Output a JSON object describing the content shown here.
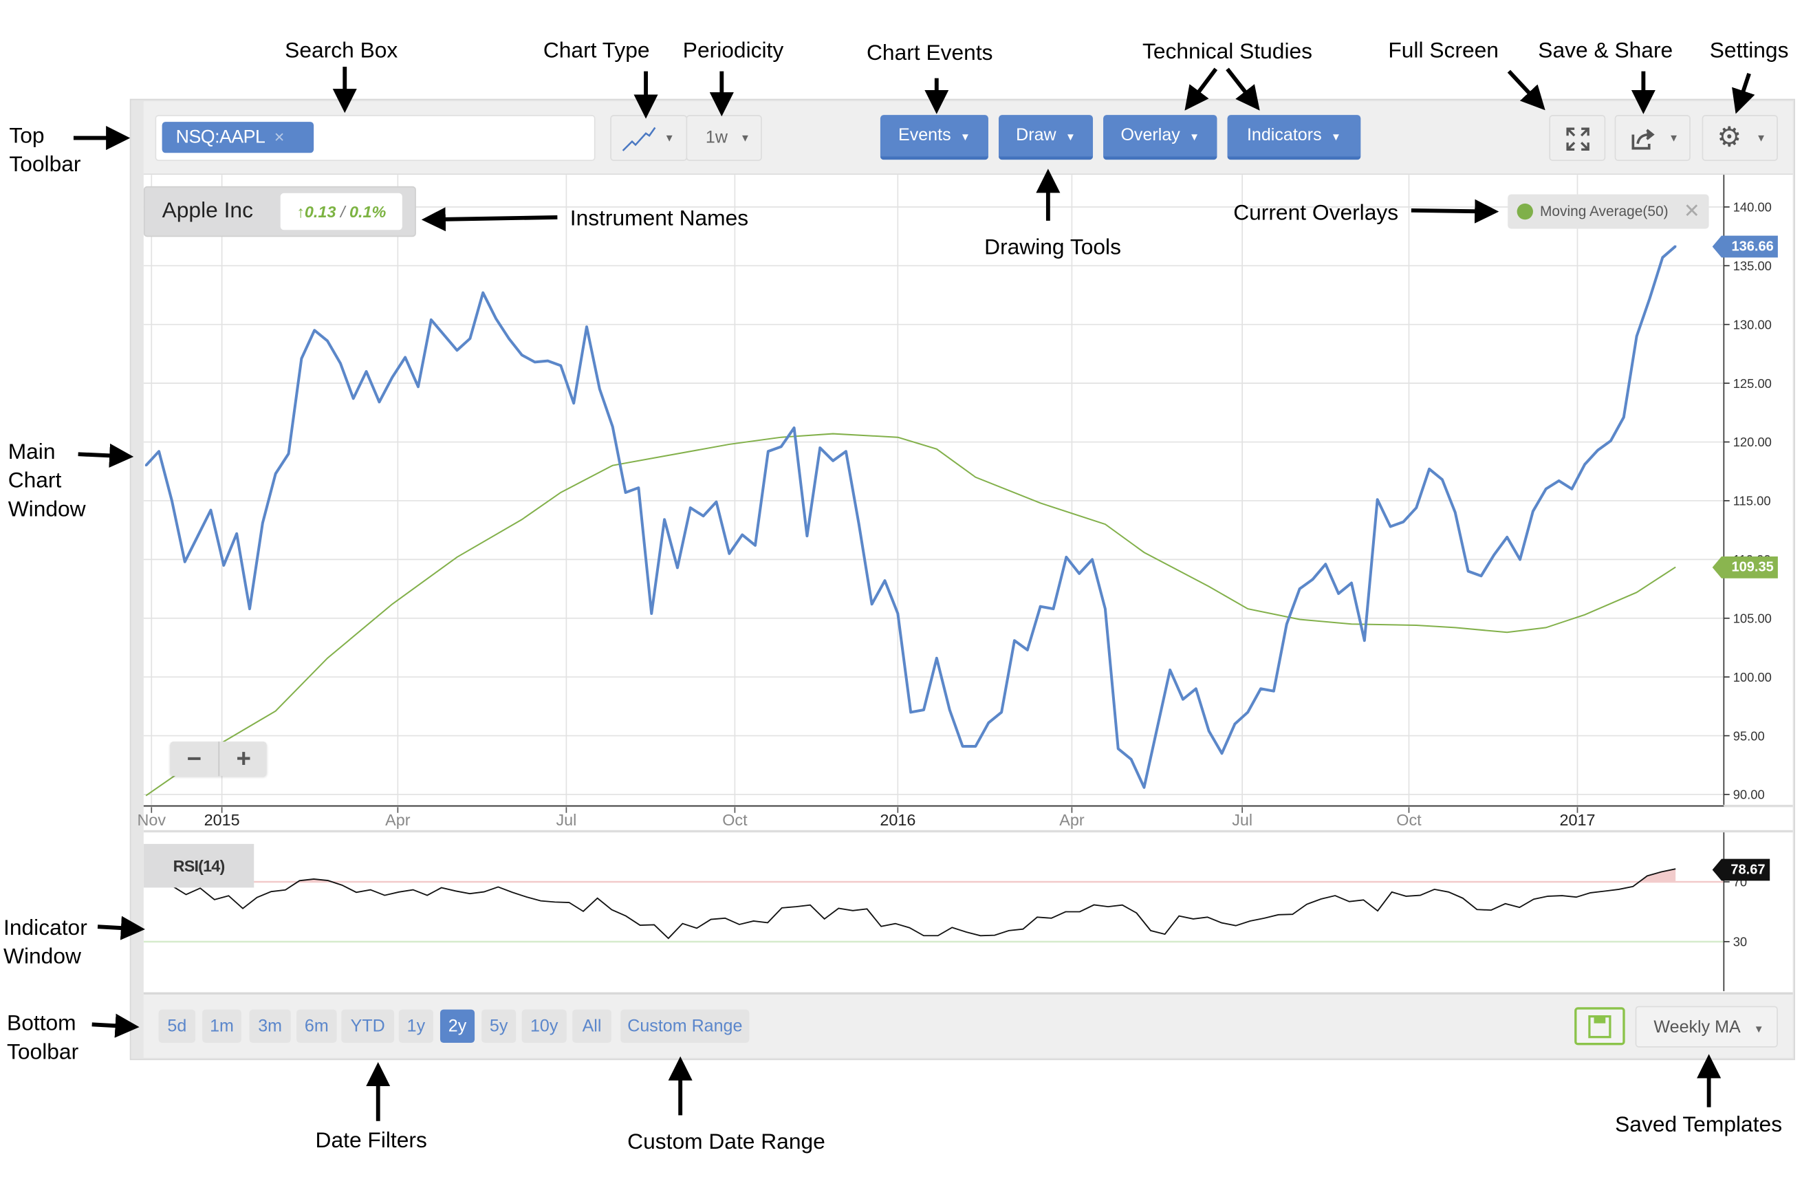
{
  "annotations": {
    "search_box": "Search Box",
    "chart_type": "Chart Type",
    "periodicity": "Periodicity",
    "chart_events": "Chart Events",
    "technical_studies": "Technical Studies",
    "full_screen": "Full Screen",
    "save_share": "Save & Share",
    "settings": "Settings",
    "top_toolbar": [
      "Top",
      "Toolbar"
    ],
    "instrument_names": "Instrument Names",
    "drawing_tools": "Drawing Tools",
    "current_overlays": "Current Overlays",
    "main_chart_window": [
      "Main",
      "Chart",
      "Window"
    ],
    "indicator_window": [
      "Indicator",
      "Window"
    ],
    "bottom_toolbar": [
      "Bottom",
      "Toolbar"
    ],
    "date_filters": "Date Filters",
    "custom_date_range": "Custom Date Range",
    "saved_templates": "Saved Templates"
  },
  "toolbar": {
    "symbol_chip": "NSQ:AAPL",
    "chip_remove": "×",
    "chart_type_icon": "line-chart-icon",
    "periodicity": "1w",
    "caret": "▼",
    "buttons": [
      "Events",
      "Draw",
      "Overlay",
      "Indicators"
    ],
    "fullscreen_icon": "expand-icon",
    "share_icon": "share-icon",
    "settings_icon": "gear-icon",
    "gear_glyph": "⚙"
  },
  "instrument": {
    "name": "Apple Inc",
    "arrow": "↑",
    "change": "0.13",
    "separator": "/",
    "change_pct": "0.1%"
  },
  "overlay_chip": {
    "label": "Moving Average(50)",
    "close": "✕"
  },
  "zoom": {
    "minus": "−",
    "plus": "+"
  },
  "colors": {
    "price": "#5b87c9",
    "ma": "#82b04a",
    "rsi": "#111111",
    "button": "#5a86cb",
    "up": "#7cb342"
  },
  "chart_data": [
    {
      "type": "line",
      "title": "",
      "ylim": [
        90,
        140
      ],
      "y_ticks": [
        "90.00",
        "95.00",
        "100.00",
        "105.00",
        "110.00",
        "115.00",
        "120.00",
        "125.00",
        "130.00",
        "135.00",
        "140.00"
      ],
      "x_ticks": [
        {
          "label": "Nov",
          "date": "2014-11-24"
        },
        {
          "label": "2015",
          "date": "2015-01-01"
        },
        {
          "label": "Apr",
          "date": "2015-04-06"
        },
        {
          "label": "Jul",
          "date": "2015-07-06"
        },
        {
          "label": "Oct",
          "date": "2015-10-05"
        },
        {
          "label": "2016",
          "date": "2016-01-01"
        },
        {
          "label": "Apr",
          "date": "2016-04-04"
        },
        {
          "label": "Jul",
          "date": "2016-07-05"
        },
        {
          "label": "Oct",
          "date": "2016-10-03"
        },
        {
          "label": "2017",
          "date": "2017-01-02"
        }
      ],
      "grid": true,
      "series": [
        {
          "name": "NSQ:AAPL",
          "last_label": "136.66",
          "dates": [
            "2014-11-21",
            "2014-11-28",
            "2014-12-05",
            "2014-12-12",
            "2014-12-19",
            "2014-12-26",
            "2015-01-02",
            "2015-01-09",
            "2015-01-16",
            "2015-01-23",
            "2015-01-30",
            "2015-02-06",
            "2015-02-13",
            "2015-02-20",
            "2015-02-27",
            "2015-03-06",
            "2015-03-13",
            "2015-03-20",
            "2015-03-27",
            "2015-04-03",
            "2015-04-10",
            "2015-04-17",
            "2015-04-24",
            "2015-05-01",
            "2015-05-08",
            "2015-05-15",
            "2015-05-22",
            "2015-05-29",
            "2015-06-05",
            "2015-06-12",
            "2015-06-19",
            "2015-06-26",
            "2015-07-03",
            "2015-07-10",
            "2015-07-17",
            "2015-07-24",
            "2015-07-31",
            "2015-08-07",
            "2015-08-14",
            "2015-08-21",
            "2015-08-28",
            "2015-09-04",
            "2015-09-11",
            "2015-09-18",
            "2015-09-25",
            "2015-10-02",
            "2015-10-09",
            "2015-10-16",
            "2015-10-23",
            "2015-10-30",
            "2015-11-06",
            "2015-11-13",
            "2015-11-20",
            "2015-11-27",
            "2015-12-04",
            "2015-12-11",
            "2015-12-18",
            "2015-12-25",
            "2016-01-01",
            "2016-01-08",
            "2016-01-15",
            "2016-01-22",
            "2016-01-29",
            "2016-02-05",
            "2016-02-12",
            "2016-02-19",
            "2016-02-26",
            "2016-03-04",
            "2016-03-11",
            "2016-03-18",
            "2016-03-25",
            "2016-04-01",
            "2016-04-08",
            "2016-04-15",
            "2016-04-22",
            "2016-04-29",
            "2016-05-06",
            "2016-05-13",
            "2016-05-20",
            "2016-05-27",
            "2016-06-03",
            "2016-06-10",
            "2016-06-17",
            "2016-06-24",
            "2016-07-01",
            "2016-07-08",
            "2016-07-15",
            "2016-07-22",
            "2016-07-29",
            "2016-08-05",
            "2016-08-12",
            "2016-08-19",
            "2016-08-26",
            "2016-09-02",
            "2016-09-09",
            "2016-09-16",
            "2016-09-23",
            "2016-09-30",
            "2016-10-07",
            "2016-10-14",
            "2016-10-21",
            "2016-10-28",
            "2016-11-04",
            "2016-11-11",
            "2016-11-18",
            "2016-11-25",
            "2016-12-02",
            "2016-12-09",
            "2016-12-16",
            "2016-12-23",
            "2016-12-30",
            "2017-01-06",
            "2017-01-13",
            "2017-01-20",
            "2017-01-27",
            "2017-02-03",
            "2017-02-10",
            "2017-02-17",
            "2017-02-24"
          ],
          "values": [
            118.0,
            119.2,
            115.0,
            109.8,
            112.0,
            114.2,
            109.5,
            112.2,
            105.8,
            113.1,
            117.3,
            119.0,
            127.1,
            129.5,
            128.6,
            126.7,
            123.7,
            126.0,
            123.4,
            125.5,
            127.2,
            124.7,
            130.4,
            129.1,
            127.8,
            128.8,
            132.7,
            130.5,
            128.8,
            127.4,
            126.8,
            126.9,
            126.5,
            123.3,
            129.8,
            124.5,
            121.3,
            115.7,
            116.1,
            105.4,
            113.4,
            109.3,
            114.4,
            113.7,
            114.9,
            110.5,
            112.1,
            111.2,
            119.2,
            119.6,
            121.2,
            112.0,
            119.5,
            118.4,
            119.2,
            113.0,
            106.2,
            108.2,
            105.4,
            97.0,
            97.2,
            101.6,
            97.2,
            94.1,
            94.1,
            96.1,
            97.0,
            103.1,
            102.3,
            106.0,
            105.8,
            110.2,
            108.8,
            110.0,
            105.8,
            93.9,
            93.0,
            90.6,
            95.6,
            100.6,
            98.1,
            99.0,
            95.4,
            93.5,
            96.0,
            97.0,
            99.0,
            98.8,
            104.5,
            107.5,
            108.3,
            109.6,
            107.1,
            108.0,
            103.1,
            115.1,
            112.8,
            113.2,
            114.4,
            117.7,
            116.8,
            114.0,
            109.0,
            108.6,
            110.4,
            111.9,
            110.0,
            114.1,
            116.0,
            116.7,
            116.0,
            118.1,
            119.3,
            120.1,
            122.1,
            129.0,
            132.2,
            135.7,
            136.66
          ]
        },
        {
          "name": "Moving Average(50)",
          "last_label": "109.35",
          "dates": [
            "2014-11-21",
            "2015-01-02",
            "2015-01-30",
            "2015-02-27",
            "2015-04-03",
            "2015-05-08",
            "2015-06-12",
            "2015-07-03",
            "2015-07-31",
            "2015-08-28",
            "2015-10-02",
            "2015-10-30",
            "2015-11-27",
            "2016-01-01",
            "2016-01-22",
            "2016-02-12",
            "2016-03-18",
            "2016-04-22",
            "2016-05-13",
            "2016-06-17",
            "2016-07-08",
            "2016-08-05",
            "2016-09-02",
            "2016-10-07",
            "2016-10-28",
            "2016-11-25",
            "2016-12-16",
            "2017-01-06",
            "2017-02-03",
            "2017-02-24"
          ],
          "values": [
            89.9,
            94.5,
            97.1,
            101.6,
            106.2,
            110.2,
            113.4,
            115.7,
            118.0,
            118.8,
            119.8,
            120.4,
            120.7,
            120.4,
            119.4,
            117.0,
            114.8,
            113.0,
            110.6,
            107.7,
            105.8,
            104.9,
            104.5,
            104.4,
            104.2,
            103.8,
            104.2,
            105.3,
            107.2,
            109.35
          ]
        }
      ]
    },
    {
      "type": "line",
      "title": "RSI(14)",
      "ylim": [
        0,
        100
      ],
      "y_ticks": [
        "70",
        "30"
      ],
      "levels": {
        "overbought": 70,
        "oversold": 30
      },
      "series": [
        {
          "name": "RSI(14)",
          "last_label": "78.67",
          "values": [
            67.4,
            61.5,
            65.8,
            58.1,
            60.7,
            52.2,
            59.6,
            63.5,
            64.6,
            70.8,
            71.9,
            70.9,
            67.8,
            63.0,
            64.7,
            61.0,
            63.2,
            64.7,
            61.0,
            66.1,
            63.9,
            62.1,
            63.3,
            66.6,
            63.0,
            59.9,
            57.3,
            56.5,
            56.2,
            50.3,
            59.1,
            51.4,
            47.2,
            41.0,
            41.3,
            32.2,
            42.1,
            39.0,
            44.9,
            45.7,
            41.5,
            43.8,
            42.7,
            52.6,
            53.4,
            54.5,
            45.2,
            52.3,
            50.8,
            51.9,
            40.2,
            42.1,
            39.3,
            34.0,
            34.0,
            39.5,
            36.4,
            34.0,
            34.3,
            37.4,
            38.4,
            46.4,
            45.7,
            50.0,
            50.0,
            54.6,
            53.4,
            54.5,
            49.2,
            37.4,
            35.0,
            47.2,
            45.2,
            46.4,
            42.6,
            40.7,
            43.8,
            45.7,
            48.0,
            48.3,
            55.0,
            58.5,
            60.8,
            56.8,
            57.9,
            50.6,
            63.2,
            60.4,
            61.0,
            65.0,
            63.2,
            59.1,
            51.5,
            51.1,
            55.4,
            52.9,
            58.4,
            60.4,
            60.8,
            59.8,
            62.7,
            63.8,
            65.0,
            66.9,
            74.0,
            76.7,
            78.67
          ]
        }
      ]
    }
  ],
  "date_filters": [
    "5d",
    "1m",
    "3m",
    "6m",
    "YTD",
    "1y",
    "2y",
    "5y",
    "10y",
    "All",
    "Custom Range"
  ],
  "date_filter_selected": "2y",
  "save_icon": "floppy-disk-icon",
  "template_select": {
    "value": "Weekly MA"
  }
}
